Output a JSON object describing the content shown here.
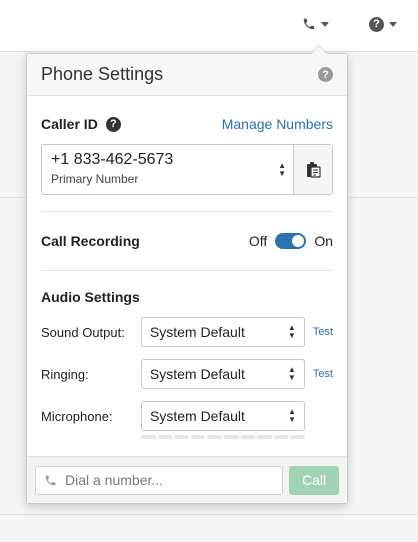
{
  "colors": {
    "accent": "#2a72b0",
    "call_button": "#9fd3b3",
    "header_bg": "#f7f7f7"
  },
  "topbar": {
    "phone_icon": "phone-icon",
    "help_icon": "question-circle-icon",
    "help_glyph": "?"
  },
  "popover": {
    "title": "Phone Settings",
    "help_glyph": "?"
  },
  "caller_id": {
    "label": "Caller ID",
    "help_glyph": "?",
    "manage_link": "Manage Numbers",
    "number": "+1 833-462-5673",
    "number_label": "Primary Number",
    "copy_icon": "clipboard-icon"
  },
  "call_recording": {
    "label": "Call Recording",
    "off_label": "Off",
    "on_label": "On",
    "state": "on"
  },
  "audio": {
    "title": "Audio Settings",
    "sound_output": {
      "label": "Sound Output:",
      "value": "System Default",
      "test": "Test"
    },
    "ringing": {
      "label": "Ringing:",
      "value": "System Default",
      "test": "Test"
    },
    "microphone": {
      "label": "Microphone:",
      "value": "System Default"
    },
    "mic_level": 0
  },
  "footer": {
    "dial_placeholder": "Dial a number...",
    "call_label": "Call"
  }
}
